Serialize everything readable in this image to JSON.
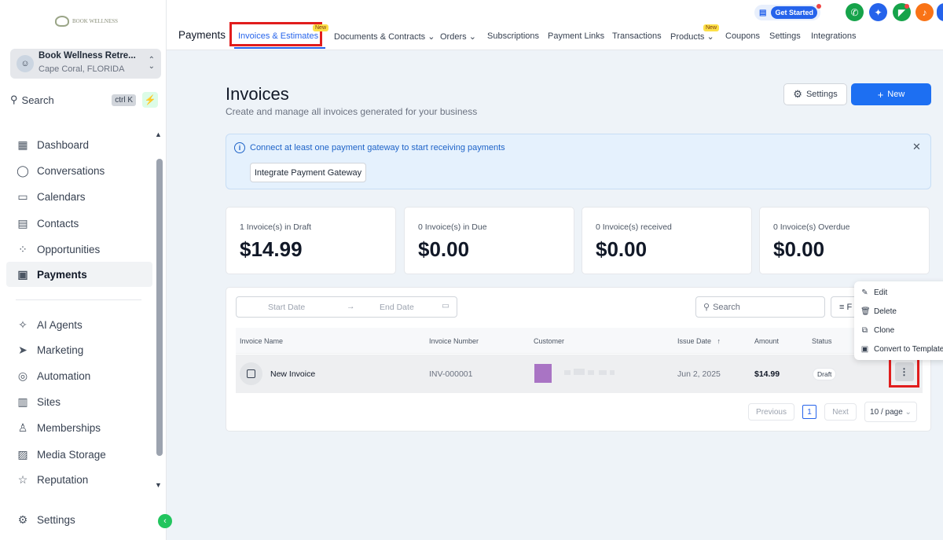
{
  "sidebar": {
    "logo_text": "BOOK WELLNESS",
    "location": {
      "name": "Book Wellness Retre...",
      "address": "Cape Coral, FLORIDA"
    },
    "search": {
      "label": "Search",
      "shortcut": "ctrl K"
    },
    "items": [
      {
        "label": "Dashboard",
        "icon": "dashboard-icon"
      },
      {
        "label": "Conversations",
        "icon": "chat-icon"
      },
      {
        "label": "Calendars",
        "icon": "calendar-icon"
      },
      {
        "label": "Contacts",
        "icon": "contacts-icon"
      },
      {
        "label": "Opportunities",
        "icon": "opportunities-icon"
      },
      {
        "label": "Payments",
        "icon": "payments-icon",
        "active": true
      },
      {
        "label": "AI Agents",
        "icon": "sparkle-icon"
      },
      {
        "label": "Marketing",
        "icon": "send-icon"
      },
      {
        "label": "Automation",
        "icon": "automation-icon"
      },
      {
        "label": "Sites",
        "icon": "sites-icon"
      },
      {
        "label": "Memberships",
        "icon": "membership-icon"
      },
      {
        "label": "Media Storage",
        "icon": "image-icon"
      },
      {
        "label": "Reputation",
        "icon": "star-icon"
      }
    ],
    "settings_label": "Settings"
  },
  "topnav": {
    "title": "Payments",
    "tabs": [
      {
        "label": "Invoices & Estimates",
        "active": true
      },
      {
        "label": "Documents & Contracts"
      },
      {
        "label": "Orders"
      },
      {
        "label": "Subscriptions"
      },
      {
        "label": "Payment Links"
      },
      {
        "label": "Transactions"
      },
      {
        "label": "Products"
      },
      {
        "label": "Coupons"
      },
      {
        "label": "Settings"
      },
      {
        "label": "Integrations"
      }
    ],
    "new_badge": "New",
    "get_started": "Get Started"
  },
  "main": {
    "title": "Invoices",
    "subtitle": "Create and manage all invoices generated for your business",
    "settings_button": "Settings",
    "new_button": "New",
    "alert": {
      "message": "Connect at least one payment gateway to start receiving payments",
      "button": "Integrate Payment Gateway"
    },
    "stats": [
      {
        "label": "1 Invoice(s) in Draft",
        "value": "$14.99"
      },
      {
        "label": "0 Invoice(s) in Due",
        "value": "$0.00"
      },
      {
        "label": "0 Invoice(s) received",
        "value": "$0.00"
      },
      {
        "label": "0 Invoice(s) Overdue",
        "value": "$0.00"
      }
    ],
    "filters": {
      "start_date": "Start Date",
      "end_date": "End Date",
      "search_placeholder": "Search",
      "filter_label": "F"
    },
    "table": {
      "columns": [
        "Invoice Name",
        "Invoice Number",
        "Customer",
        "Issue Date",
        "Amount",
        "Status"
      ],
      "rows": [
        {
          "name": "New Invoice",
          "number": "INV-000001",
          "issue_date": "Jun 2, 2025",
          "amount": "$14.99",
          "status": "Draft"
        }
      ]
    },
    "pagination": {
      "previous": "Previous",
      "current": "1",
      "next": "Next",
      "page_size": "10 / page"
    },
    "row_menu": [
      "Edit",
      "Delete",
      "Clone",
      "Convert to Template"
    ]
  }
}
